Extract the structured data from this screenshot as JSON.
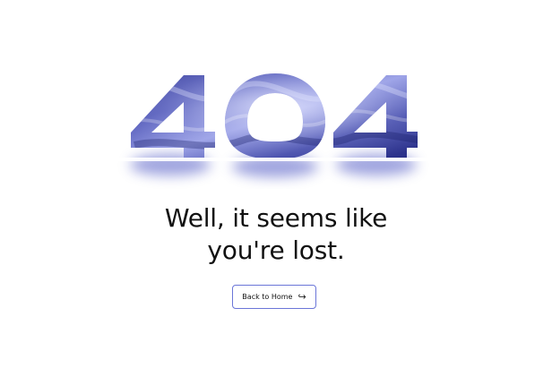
{
  "hero": {
    "code": "404",
    "texture_colors": {
      "deep": "#2a2f8f",
      "mid": "#4b52b4",
      "light": "#b9bff2",
      "highlight": "#e6e8ff"
    }
  },
  "message": {
    "line1": "Well, it seems like",
    "line2": "you're lost."
  },
  "back_button": {
    "label": "Back to Home",
    "icon": "return-arrow-icon",
    "border_color": "#6b76d8"
  }
}
